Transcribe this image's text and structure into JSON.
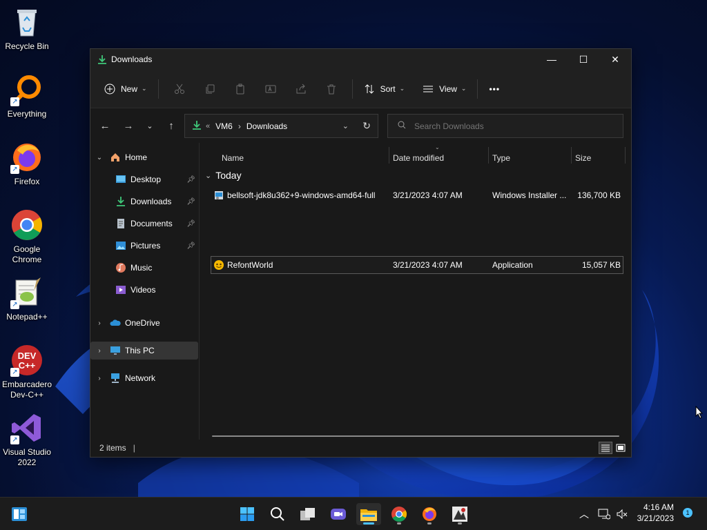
{
  "desktop": {
    "icons": [
      {
        "label": "Recycle Bin",
        "icon": "recycle-bin-icon"
      },
      {
        "label": "Everything",
        "icon": "everything-search-icon"
      },
      {
        "label": "Firefox",
        "icon": "firefox-icon"
      },
      {
        "label": "Google Chrome",
        "icon": "chrome-icon"
      },
      {
        "label": "Notepad++",
        "icon": "notepadpp-icon"
      },
      {
        "label": "Embarcadero Dev-C++",
        "icon": "devcpp-icon"
      },
      {
        "label": "Visual Studio 2022",
        "icon": "visual-studio-icon"
      }
    ]
  },
  "window": {
    "title": "Downloads",
    "controls": {
      "minimize": "—",
      "maximize": "☐",
      "close": "✕"
    }
  },
  "toolbar": {
    "new_label": "New",
    "sort_label": "Sort",
    "view_label": "View",
    "more_label": "•••",
    "icons": [
      "cut-icon",
      "copy-icon",
      "paste-icon",
      "rename-icon",
      "share-icon",
      "delete-icon"
    ]
  },
  "address": {
    "overflow": "«",
    "crumbs": [
      "VM6",
      "Downloads"
    ],
    "separator": "›"
  },
  "search": {
    "placeholder": "Search Downloads"
  },
  "sidebar": {
    "items": [
      {
        "label": "Home",
        "icon": "home-icon",
        "expanded": true
      },
      {
        "label": "Desktop",
        "icon": "desktop-folder-icon",
        "pinned": true
      },
      {
        "label": "Downloads",
        "icon": "downloads-folder-icon",
        "pinned": true
      },
      {
        "label": "Documents",
        "icon": "documents-folder-icon",
        "pinned": true
      },
      {
        "label": "Pictures",
        "icon": "pictures-folder-icon",
        "pinned": true
      },
      {
        "label": "Music",
        "icon": "music-folder-icon"
      },
      {
        "label": "Videos",
        "icon": "videos-folder-icon"
      },
      {
        "label": "OneDrive",
        "icon": "onedrive-icon"
      },
      {
        "label": "This PC",
        "icon": "this-pc-icon",
        "selected": true
      },
      {
        "label": "Network",
        "icon": "network-icon"
      }
    ]
  },
  "filelist": {
    "columns": [
      "Name",
      "Date modified",
      "Type",
      "Size"
    ],
    "group": "Today",
    "rows": [
      {
        "name": "bellsoft-jdk8u362+9-windows-amd64-full",
        "date": "3/21/2023 4:07 AM",
        "type": "Windows Installer ...",
        "size": "136,700 KB"
      },
      {
        "name": "RefontWorld",
        "date": "3/21/2023 4:07 AM",
        "type": "Application",
        "size": "15,057 KB"
      }
    ]
  },
  "status": {
    "items": "2 items",
    "separator": "|"
  },
  "taskbar": {
    "apps": [
      "windows-start-icon",
      "search-icon",
      "task-view-icon",
      "chat-icon",
      "file-explorer-icon",
      "chrome-icon",
      "firefox-icon",
      "app-icon"
    ],
    "time": "4:16 AM",
    "date": "3/21/2023",
    "notifications": "1"
  },
  "colors": {
    "accent": "#4cc2ff",
    "window_bg": "#191919",
    "toolbar_bg": "#202020"
  }
}
